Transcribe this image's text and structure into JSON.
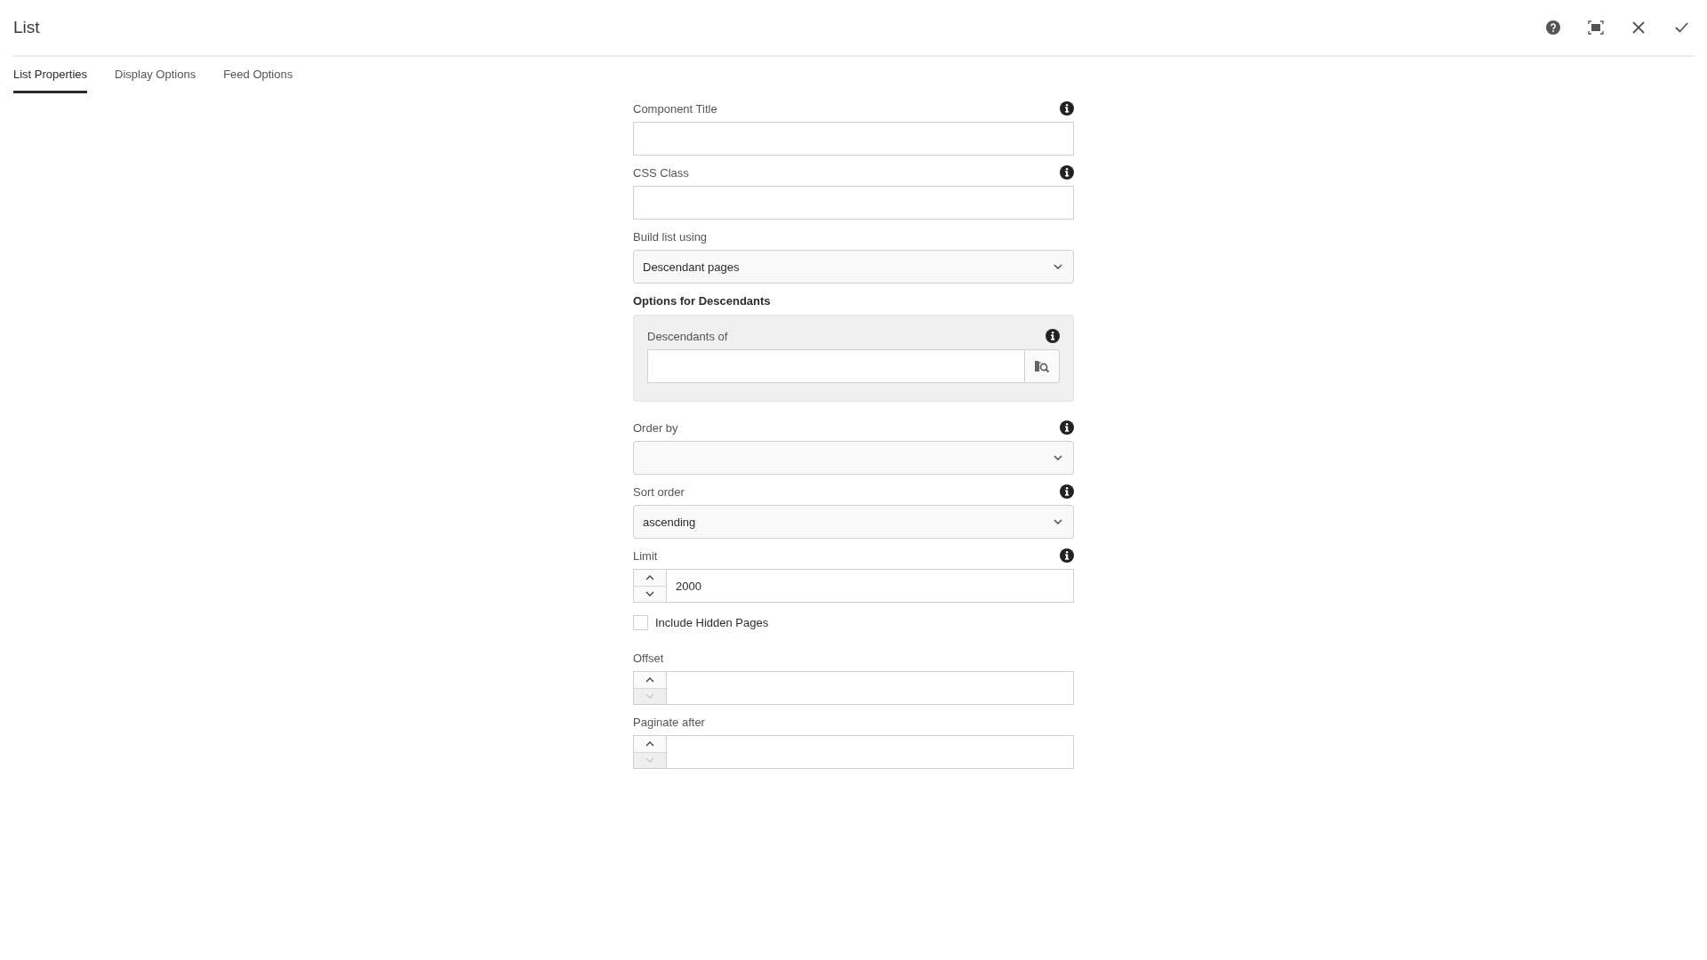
{
  "dialog": {
    "title": "List"
  },
  "toolbar": [
    {
      "kind": "help"
    },
    {
      "kind": "fullscreen"
    },
    {
      "kind": "close"
    },
    {
      "kind": "done"
    }
  ],
  "tabs": [
    {
      "label": "List Properties",
      "selected": true
    },
    {
      "label": "Display Options",
      "selected": false
    },
    {
      "label": "Feed Options",
      "selected": false
    }
  ],
  "fields": [
    {
      "kind": "text",
      "label": "Component Title",
      "info": true
    },
    {
      "kind": "text",
      "label": "CSS Class",
      "info": true
    },
    {
      "kind": "select",
      "label": "Build list using",
      "info": false,
      "value": "Descendant pages"
    },
    {
      "kind": "group",
      "heading": "Options for Descendants",
      "fields": [
        {
          "kind": "path",
          "label": "Descendants of",
          "info": true
        }
      ]
    },
    {
      "kind": "select",
      "label": "Order by",
      "info": true
    },
    {
      "kind": "select",
      "label": "Sort order",
      "info": true,
      "value": "ascending"
    },
    {
      "kind": "number",
      "label": "Limit",
      "info": true,
      "value": "2000",
      "decrement_disabled": false
    },
    {
      "kind": "checkbox",
      "label": "Include Hidden Pages",
      "checked": false
    },
    {
      "kind": "number",
      "label": "Offset",
      "info": false,
      "decrement_disabled": true
    },
    {
      "kind": "number",
      "label": "Paginate after",
      "info": false,
      "decrement_disabled": true
    }
  ]
}
